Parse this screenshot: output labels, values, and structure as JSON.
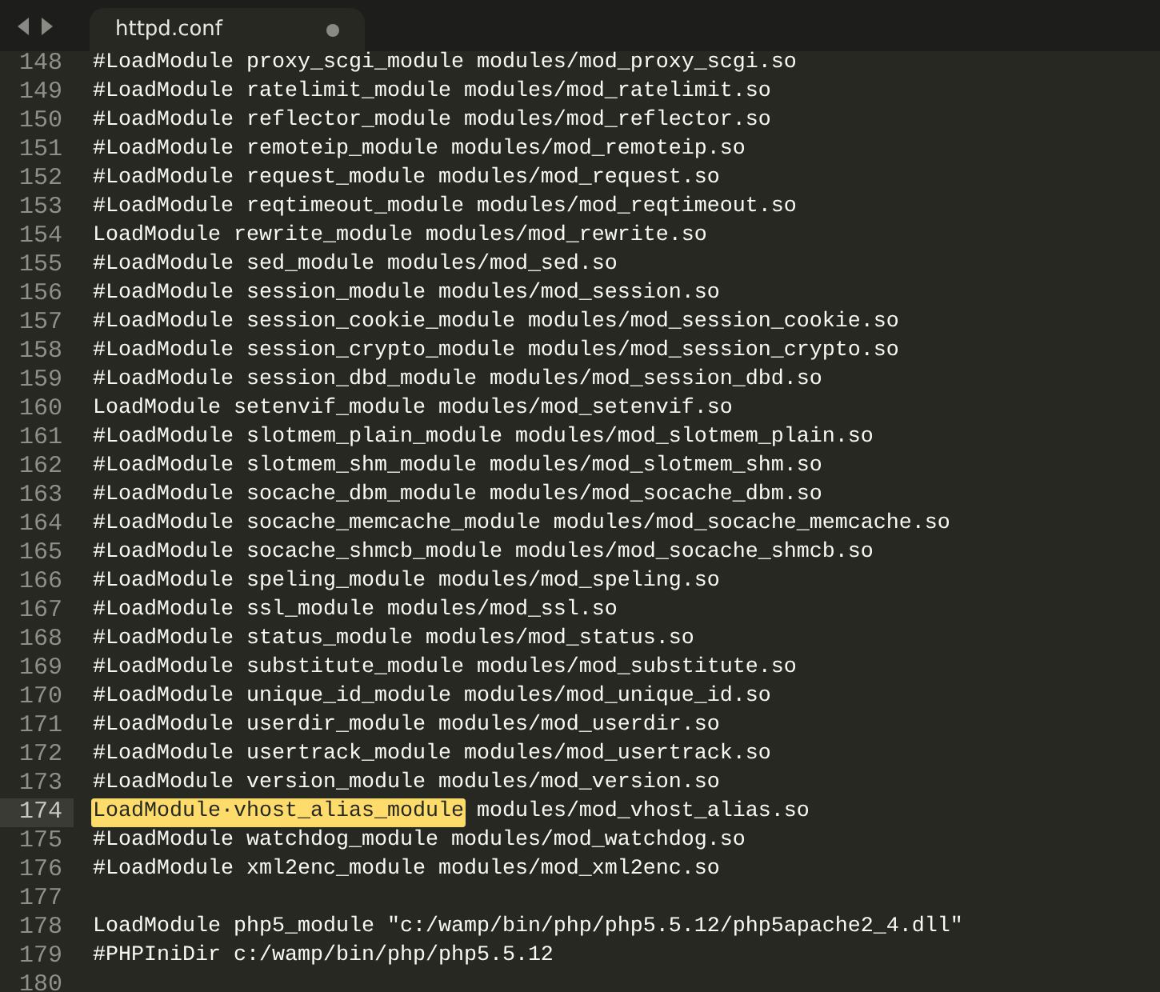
{
  "tab": {
    "title": "httpd.conf",
    "modified": true
  },
  "lines": [
    {
      "number": "148",
      "text": "#LoadModule proxy_scgi_module modules/mod_proxy_scgi.so"
    },
    {
      "number": "149",
      "text": "#LoadModule ratelimit_module modules/mod_ratelimit.so"
    },
    {
      "number": "150",
      "text": "#LoadModule reflector_module modules/mod_reflector.so"
    },
    {
      "number": "151",
      "text": "#LoadModule remoteip_module modules/mod_remoteip.so"
    },
    {
      "number": "152",
      "text": "#LoadModule request_module modules/mod_request.so"
    },
    {
      "number": "153",
      "text": "#LoadModule reqtimeout_module modules/mod_reqtimeout.so"
    },
    {
      "number": "154",
      "text": "LoadModule rewrite_module modules/mod_rewrite.so"
    },
    {
      "number": "155",
      "text": "#LoadModule sed_module modules/mod_sed.so"
    },
    {
      "number": "156",
      "text": "#LoadModule session_module modules/mod_session.so"
    },
    {
      "number": "157",
      "text": "#LoadModule session_cookie_module modules/mod_session_cookie.so"
    },
    {
      "number": "158",
      "text": "#LoadModule session_crypto_module modules/mod_session_crypto.so"
    },
    {
      "number": "159",
      "text": "#LoadModule session_dbd_module modules/mod_session_dbd.so"
    },
    {
      "number": "160",
      "text": "LoadModule setenvif_module modules/mod_setenvif.so"
    },
    {
      "number": "161",
      "text": "#LoadModule slotmem_plain_module modules/mod_slotmem_plain.so"
    },
    {
      "number": "162",
      "text": "#LoadModule slotmem_shm_module modules/mod_slotmem_shm.so"
    },
    {
      "number": "163",
      "text": "#LoadModule socache_dbm_module modules/mod_socache_dbm.so"
    },
    {
      "number": "164",
      "text": "#LoadModule socache_memcache_module modules/mod_socache_memcache.so"
    },
    {
      "number": "165",
      "text": "#LoadModule socache_shmcb_module modules/mod_socache_shmcb.so"
    },
    {
      "number": "166",
      "text": "#LoadModule speling_module modules/mod_speling.so"
    },
    {
      "number": "167",
      "text": "#LoadModule ssl_module modules/mod_ssl.so"
    },
    {
      "number": "168",
      "text": "#LoadModule status_module modules/mod_status.so"
    },
    {
      "number": "169",
      "text": "#LoadModule substitute_module modules/mod_substitute.so"
    },
    {
      "number": "170",
      "text": "#LoadModule unique_id_module modules/mod_unique_id.so"
    },
    {
      "number": "171",
      "text": "#LoadModule userdir_module modules/mod_userdir.so"
    },
    {
      "number": "172",
      "text": "#LoadModule usertrack_module modules/mod_usertrack.so"
    },
    {
      "number": "173",
      "text": "#LoadModule version_module modules/mod_version.so"
    },
    {
      "number": "174",
      "current": true,
      "selection": "LoadModule·vhost_alias_module",
      "text": " modules/mod_vhost_alias.so"
    },
    {
      "number": "175",
      "text": "#LoadModule watchdog_module modules/mod_watchdog.so"
    },
    {
      "number": "176",
      "text": "#LoadModule xml2enc_module modules/mod_xml2enc.so"
    },
    {
      "number": "177"
    },
    {
      "number": "178",
      "text": "LoadModule php5_module \"c:/wamp/bin/php/php5.5.12/php5apache2_4.dll\""
    },
    {
      "number": "179",
      "text": "#PHPIniDir c:/wamp/bin/php/php5.5.12"
    },
    {
      "number": "180"
    }
  ]
}
